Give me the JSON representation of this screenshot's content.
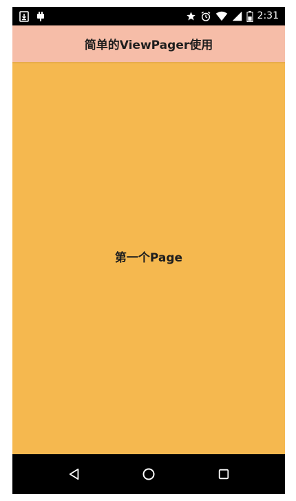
{
  "status_bar": {
    "left_icons": [
      "download-notification-icon",
      "android-debug-icon"
    ],
    "right_icons": [
      "star-icon",
      "alarm-icon",
      "wifi-icon",
      "signal-icon",
      "battery-icon"
    ],
    "time": "2:31"
  },
  "app_bar": {
    "title": "简单的ViewPager使用",
    "background": "#f6bda8"
  },
  "pager": {
    "current_page_label": "第一个Page",
    "background": "#f5b84f"
  },
  "nav_bar": {
    "buttons": [
      "back-icon",
      "home-icon",
      "recents-icon"
    ]
  }
}
